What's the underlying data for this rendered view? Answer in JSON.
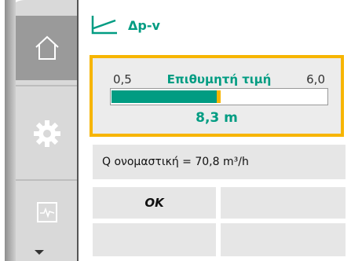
{
  "header": {
    "mode_icon": "control-curve-icon",
    "mode_label": "Δp-v"
  },
  "setpoint": {
    "min_label": "0,5",
    "max_label": "6,0",
    "title": "Επιθυμητή τιμή",
    "value_label": "8,3 m",
    "bar_fraction": 0.49
  },
  "info": {
    "text": "Q ονομαστική = 70,8 m³/h"
  },
  "buttons": {
    "ok_label": "OK"
  },
  "nav": {
    "home_icon": "home-icon",
    "settings_icon": "gear-icon",
    "diagnostics_icon": "diagnostics-icon",
    "more_icon": "chevron-down-icon"
  },
  "colors": {
    "accent": "#009c82",
    "highlight": "#f7b500",
    "panel": "#e6e6e6"
  }
}
